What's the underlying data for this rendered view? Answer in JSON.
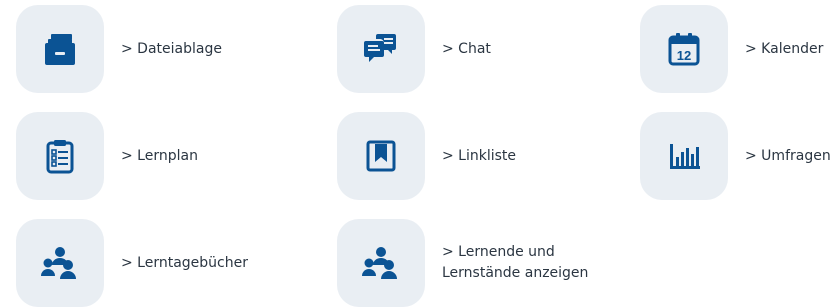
{
  "colors": {
    "tile_background": "#e9eef3",
    "icon": "#0b5394",
    "text": "#2b3642"
  },
  "tiles": [
    {
      "label": "> Dateiablage",
      "icon": "folder-briefcase-icon"
    },
    {
      "label": "> Chat",
      "icon": "chat-bubbles-icon"
    },
    {
      "label": "> Kalender",
      "icon": "calendar-icon",
      "icon_text": "12"
    },
    {
      "label": "> Lernplan",
      "icon": "clipboard-list-icon"
    },
    {
      "label": "> Linkliste",
      "icon": "bookmark-icon"
    },
    {
      "label": "> Umfragen",
      "icon": "bar-chart-icon"
    },
    {
      "label": "> Lerntagebücher",
      "icon": "users-icon"
    },
    {
      "label_line1": "> Lernende und",
      "label_line2": "Lernstände anzeigen",
      "icon": "users-icon"
    }
  ]
}
